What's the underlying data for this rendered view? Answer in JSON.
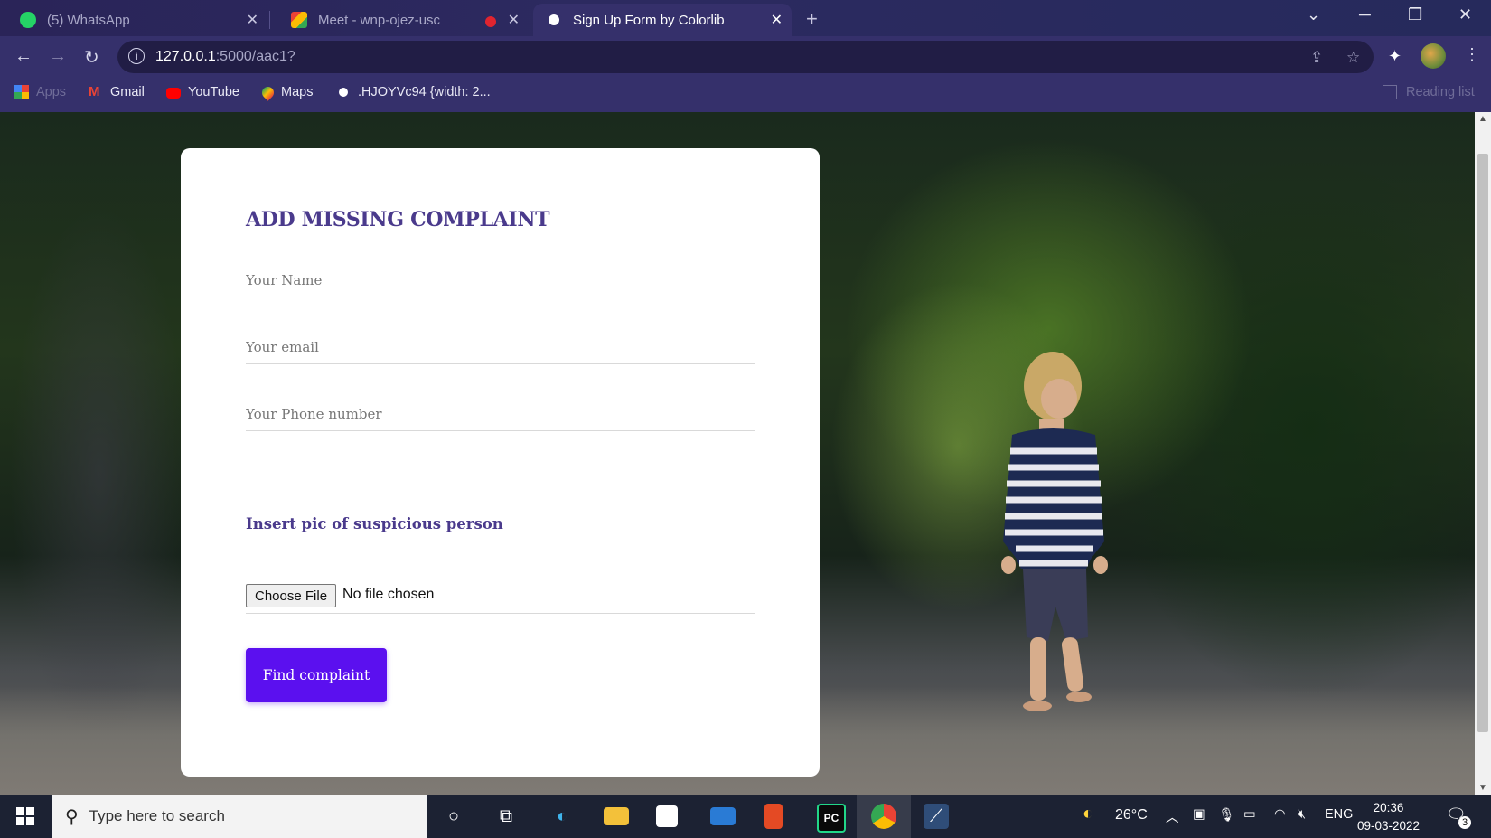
{
  "tabs": [
    {
      "title": "(5) WhatsApp",
      "active": false
    },
    {
      "title": "Meet - wnp-ojez-usc",
      "active": false
    },
    {
      "title": "Sign Up Form by Colorlib",
      "active": true
    }
  ],
  "address_bar": {
    "host": "127.0.0.1",
    "rest": ":5000/aac1?"
  },
  "bookmarks": [
    {
      "label": "Apps"
    },
    {
      "label": "Gmail"
    },
    {
      "label": "YouTube"
    },
    {
      "label": "Maps"
    },
    {
      "label": ".HJOYVc94 {width: 2..."
    }
  ],
  "reading_list": "Reading list",
  "form": {
    "title": "ADD MISSING COMPLAINT",
    "name_placeholder": "Your Name",
    "email_placeholder": "Your email",
    "phone_placeholder": "Your Phone number",
    "pic_label": "Insert pic of suspicious person",
    "file_button": "Choose File",
    "file_status": "No file chosen",
    "submit_label": "Find complaint"
  },
  "taskbar": {
    "search_placeholder": "Type here to search",
    "temperature": "26°C",
    "language": "ENG",
    "time": "20:36",
    "date": "09-03-2022",
    "notification_count": "3"
  },
  "colors": {
    "accent": "#5b10ef",
    "heading": "#4a3a8c",
    "chrome_frame": "#35306b"
  }
}
